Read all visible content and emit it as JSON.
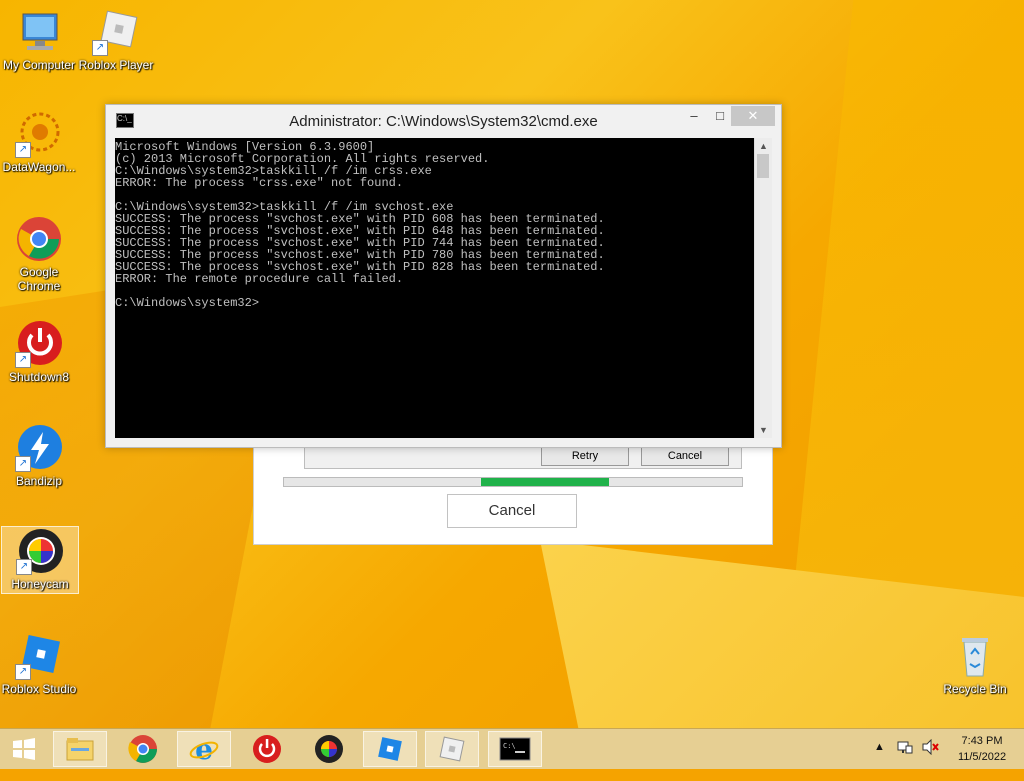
{
  "desktop_icons": [
    {
      "label": "My Computer"
    },
    {
      "label": "Roblox Player"
    },
    {
      "label": "DataWagon..."
    },
    {
      "label": "Google Chrome"
    },
    {
      "label": "Shutdown8"
    },
    {
      "label": "Bandizip"
    },
    {
      "label": "Honeycam"
    },
    {
      "label": "Roblox Studio"
    },
    {
      "label": "Recycle Bin"
    }
  ],
  "cmd": {
    "title": "Administrator: C:\\Windows\\System32\\cmd.exe",
    "lines": "Microsoft Windows [Version 6.3.9600]\n(c) 2013 Microsoft Corporation. All rights reserved.\nC:\\Windows\\system32>taskkill /f /im crss.exe\nERROR: The process \"crss.exe\" not found.\n\nC:\\Windows\\system32>taskkill /f /im svchost.exe\nSUCCESS: The process \"svchost.exe\" with PID 608 has been terminated.\nSUCCESS: The process \"svchost.exe\" with PID 648 has been terminated.\nSUCCESS: The process \"svchost.exe\" with PID 744 has been terminated.\nSUCCESS: The process \"svchost.exe\" with PID 780 has been terminated.\nSUCCESS: The process \"svchost.exe\" with PID 828 has been terminated.\nERROR: The remote procedure call failed.\n\nC:\\Windows\\system32>",
    "minimize": "–",
    "maximize": "□",
    "close": "✕"
  },
  "bg_dialog": {
    "retry_label": "Retry",
    "cancel_small_label": "Cancel",
    "cancel_label": "Cancel",
    "progress": 0.28
  },
  "taskbar": {
    "items": [
      "start",
      "file-explorer",
      "chrome",
      "internet-explorer",
      "shutdown8",
      "honeycam",
      "roblox-studio",
      "roblox-player",
      "cmd"
    ],
    "time": "7:43 PM",
    "date": "11/5/2022"
  },
  "colors": {
    "accent": "#f7b500",
    "progress": "#20b24a"
  }
}
